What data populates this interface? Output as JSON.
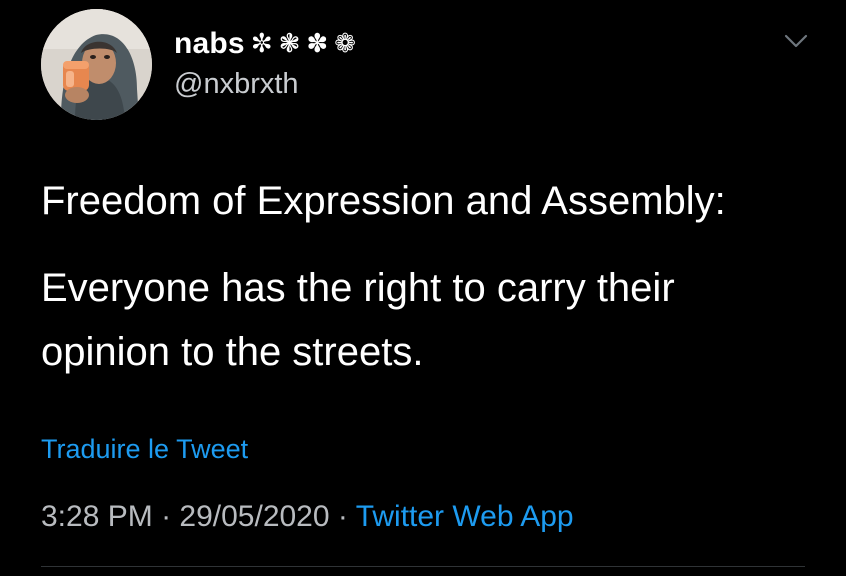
{
  "author": {
    "display_name": "nabs",
    "flower_1": "✼",
    "flower_2": "❃",
    "flower_3": "✽",
    "flower_4": "❁",
    "handle": "@nxbrxth"
  },
  "tweet": {
    "line_1": "Freedom of Expression and Assembly:",
    "line_2": "Everyone has the right to carry their",
    "line_3": "opinion to the streets.",
    "translate_label": "Traduire le Tweet"
  },
  "meta": {
    "time": "3:28 PM",
    "separator_1": " · ",
    "date": "29/05/2020",
    "separator_2": " · ",
    "source": "Twitter Web App"
  },
  "icons": {
    "menu": "chevron-down-icon"
  },
  "colors": {
    "background": "#000000",
    "text": "#ffffff",
    "secondary_text": "#b8bbbf",
    "link": "#1d9bf0"
  }
}
